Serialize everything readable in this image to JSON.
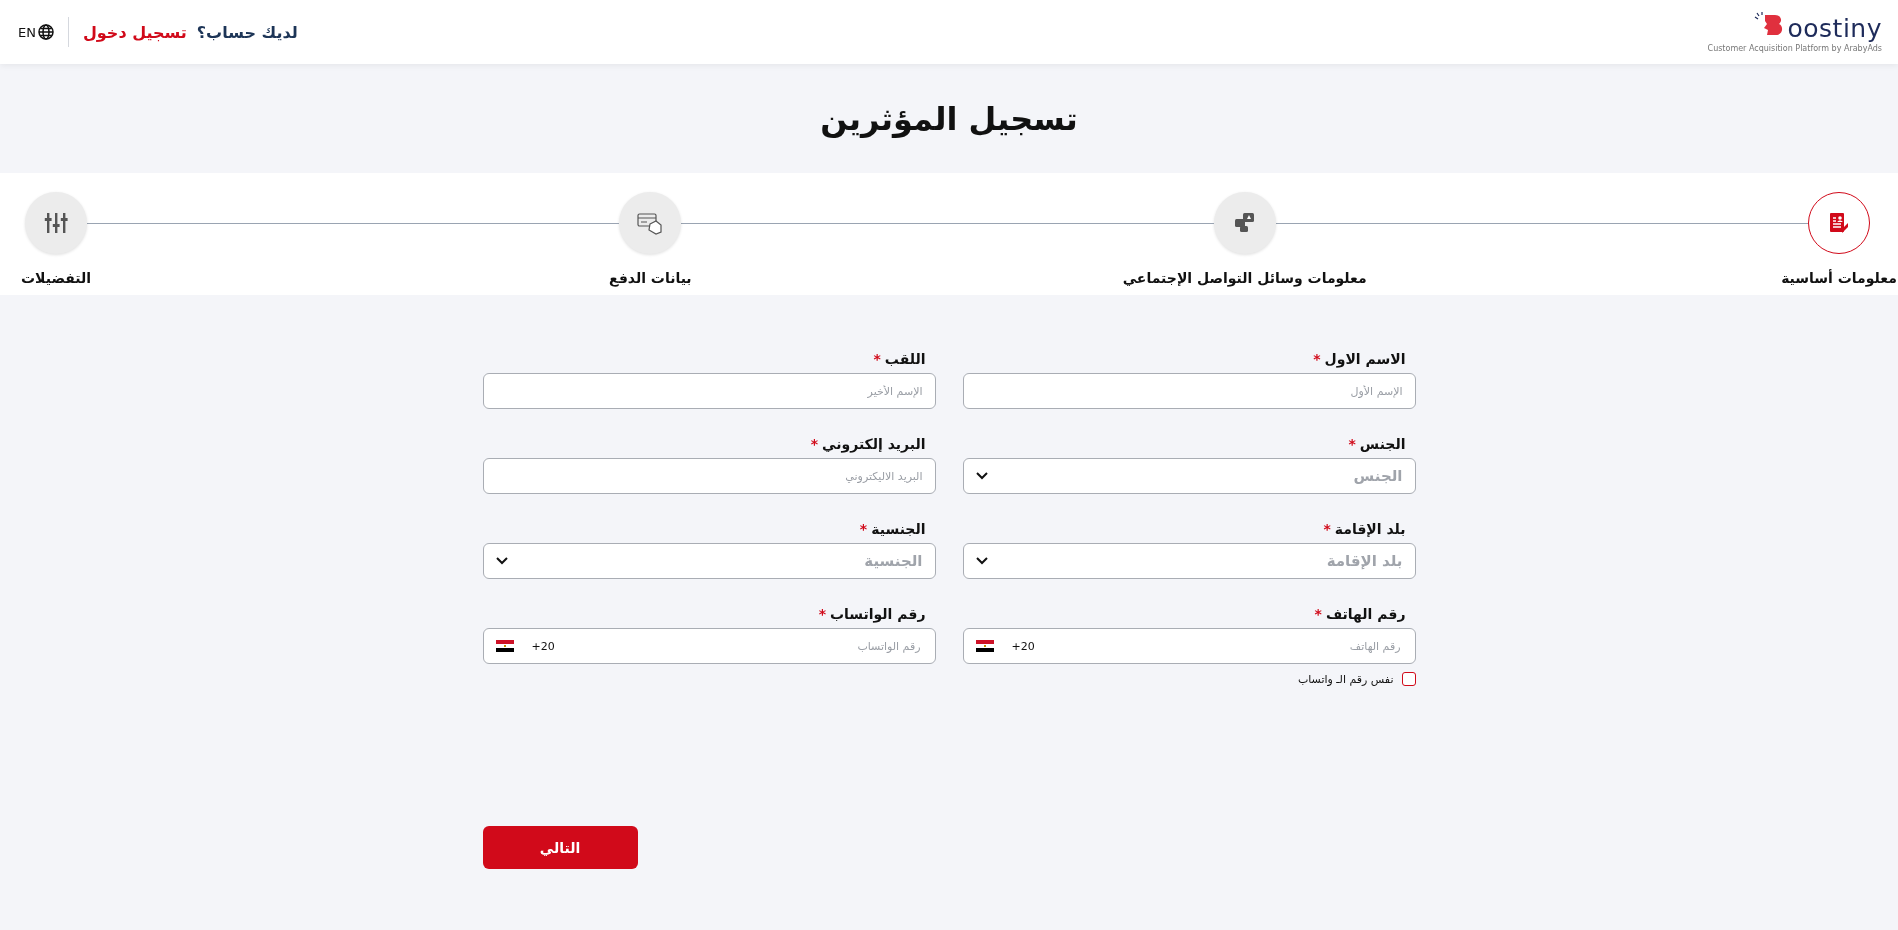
{
  "header": {
    "logo": {
      "name": "oostiny",
      "tagline": "Customer Acquisition Platform by ArabyAds"
    },
    "account_question": "لديك حساب؟",
    "login_link": "تسجيل دخول",
    "language": "EN"
  },
  "page_title": "تسجيل المؤثرين",
  "steps": [
    {
      "label": "معلومات أساسية",
      "kind": "profile",
      "selected": true
    },
    {
      "label": "معلومات وسائل التواصل الإجتماعي",
      "kind": "social",
      "selected": false
    },
    {
      "label": "بيانات الدفع",
      "kind": "payment",
      "selected": false
    },
    {
      "label": "التفضيلات",
      "kind": "preferences",
      "selected": false
    }
  ],
  "fields": [
    {
      "kind": "text",
      "label": "الاسم الاول",
      "required_mark": "*",
      "placeholder": "الإسم الأول"
    },
    {
      "kind": "text",
      "label": "اللقب",
      "required_mark": "*",
      "placeholder": "الإسم الأخير"
    },
    {
      "kind": "select",
      "label": "الجنس",
      "required_mark": "*",
      "placeholder": "الجنس"
    },
    {
      "kind": "text",
      "label": "البريد إلكتروني",
      "required_mark": "*",
      "placeholder": "البريد الاليكتروني"
    },
    {
      "kind": "select",
      "label": "بلد الإقامة",
      "required_mark": "*",
      "placeholder": "بلد الإقامة"
    },
    {
      "kind": "select",
      "label": "الجنسية",
      "required_mark": "*",
      "placeholder": "الجنسية"
    },
    {
      "kind": "phone",
      "label": "رقم الهاتف",
      "required_mark": "*",
      "placeholder": "رقم الهاتف",
      "dial_code": "+20",
      "same_whatsapp": {
        "label": "نفس رقم الـ واتساب",
        "checked": false
      }
    },
    {
      "kind": "phone",
      "label": "رقم الواتساب",
      "required_mark": "*",
      "placeholder": "رقم الواتساب",
      "dial_code": "+20"
    }
  ],
  "next_button": "التالي"
}
